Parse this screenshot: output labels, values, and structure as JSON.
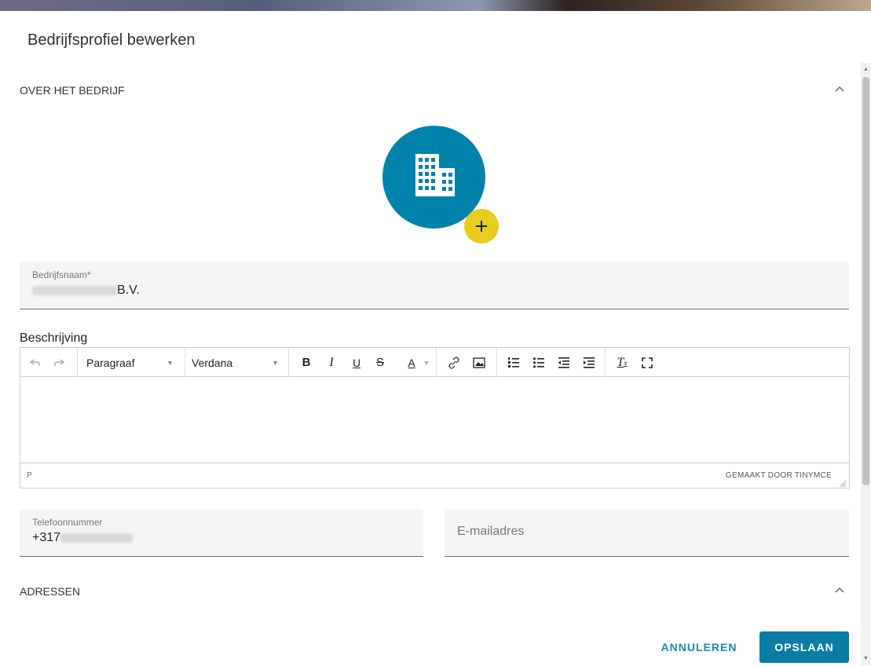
{
  "dialog": {
    "title": "Bedrijfsprofiel bewerken"
  },
  "sections": {
    "about": {
      "label": "OVER HET BEDRIJF"
    },
    "addresses": {
      "label": "ADRESSEN"
    }
  },
  "company_name": {
    "label": "Bedrijfsnaam*",
    "value_visible_suffix": "B.V."
  },
  "description": {
    "label": "Beschrijving",
    "toolbar": {
      "block_format": "Paragraaf",
      "font_family": "Verdana",
      "buttons": [
        "undo-icon",
        "redo-icon",
        "bold-icon",
        "italic-icon",
        "underline-icon",
        "strikethrough-icon",
        "text-color-icon",
        "link-icon",
        "image-icon",
        "numbered-list-icon",
        "bullet-list-icon",
        "outdent-icon",
        "indent-icon",
        "clear-formatting-icon",
        "fullscreen-icon"
      ]
    },
    "statusbar": {
      "path": "P",
      "branding": "GEMAAKT DOOR TINYMCE"
    }
  },
  "phone": {
    "label": "Telefoonnummer",
    "value_visible_prefix": "+317"
  },
  "email": {
    "placeholder": "E-mailadres",
    "value": ""
  },
  "actions": {
    "cancel": "ANNULEREN",
    "save": "OPSLAAN"
  },
  "colors": {
    "accent": "#0a7ca6",
    "avatar_bg": "#0083aa",
    "add_button": "#e6cd1e",
    "field_bg": "#f5f5f5"
  }
}
